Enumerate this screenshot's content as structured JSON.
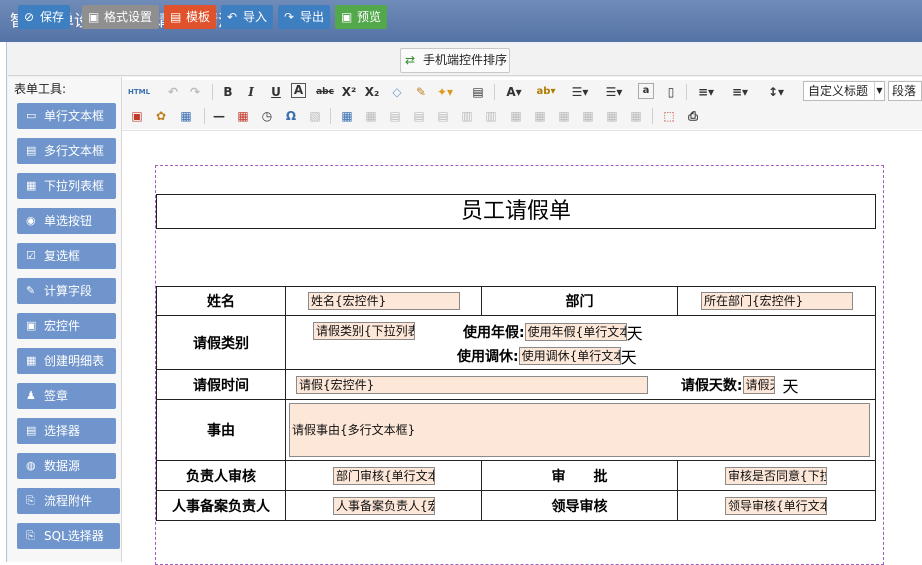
{
  "app": {
    "title": "智能表单设计器 - 《请假申请流程》"
  },
  "toolbar": {
    "save": "保存",
    "format": "格式设置",
    "template": "模板",
    "import": "导入",
    "export": "导出",
    "preview": "预览",
    "mobile_sort": "手机端控件排序"
  },
  "left_panel": {
    "title": "表单工具:",
    "tools": [
      {
        "label": "单行文本框",
        "icon": "textbox-icon"
      },
      {
        "label": "多行文本框",
        "icon": "textarea-icon"
      },
      {
        "label": "下拉列表框",
        "icon": "dropdown-icon"
      },
      {
        "label": "单选按钮",
        "icon": "radio-icon"
      },
      {
        "label": "复选框",
        "icon": "checkbox-icon"
      },
      {
        "label": "计算字段",
        "icon": "calculator-icon"
      },
      {
        "label": "宏控件",
        "icon": "macro-icon"
      },
      {
        "label": "创建明细表",
        "icon": "detail-table-icon"
      },
      {
        "label": "签章",
        "icon": "signature-icon"
      },
      {
        "label": "选择器",
        "icon": "selector-icon"
      },
      {
        "label": "数据源",
        "icon": "datasource-icon"
      },
      {
        "label": "流程附件",
        "icon": "attachment-icon"
      },
      {
        "label": "SQL选择器",
        "icon": "sql-icon"
      }
    ]
  },
  "editor_toolbar": {
    "html_label": "HTML",
    "heading_select": "自定义标题",
    "paragraph_select": "段落"
  },
  "form": {
    "title": "员工请假单",
    "rows": {
      "name_label": "姓名",
      "name_field": "姓名{宏控件}",
      "dept_label": "部门",
      "dept_field": "所在部门{宏控件}",
      "leave_type_label": "请假类别",
      "leave_type_field": "请假类别{下拉列表框}",
      "annual_label": "使用年假:",
      "annual_field": "使用年假{单行文本框}",
      "day_unit": "天",
      "comp_label": "使用调休:",
      "comp_field": "使用调休{单行文本框}",
      "leave_time_label": "请假时间",
      "leave_time_field": "请假{宏控件}",
      "leave_days_label": "请假天数:",
      "leave_days_field": "请假天数",
      "reason_label": "事由",
      "reason_field": "请假事由{多行文本框}",
      "manager_label": "负责人审核",
      "manager_field": "部门审核{单行文本框}",
      "approve_label": "审　　批",
      "approve_field": "审核是否同意{下拉列表框}",
      "hr_label": "人事备案负责人",
      "hr_field": "人事备案负责人{宏控件}",
      "leader_label": "领导审核",
      "leader_field": "领导审核{单行文本框}"
    }
  }
}
